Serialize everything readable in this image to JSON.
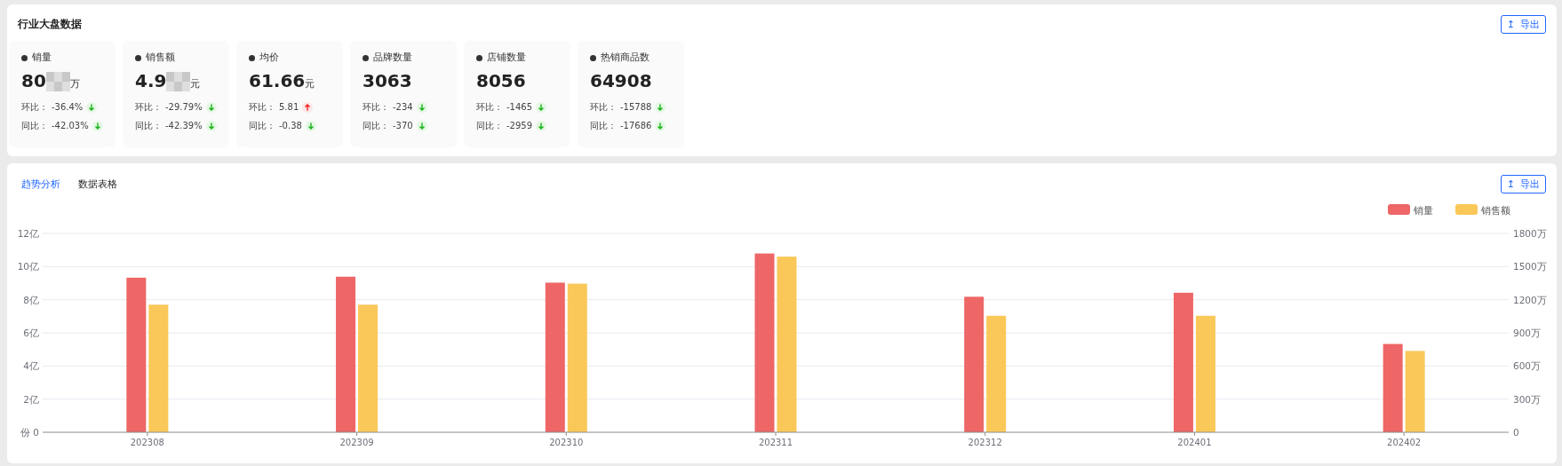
{
  "overview": {
    "title": "行业大盘数据",
    "export_button": {
      "icon": "↥",
      "label": "导出"
    },
    "metrics": [
      {
        "name": "销量",
        "value": "80",
        "unit": "万",
        "redacted": true,
        "rows": [
          {
            "label": "环比：",
            "value": "-36.4%",
            "rising": false
          },
          {
            "label": "同比：",
            "value": "-42.03%",
            "rising": false
          }
        ]
      },
      {
        "name": "销售额",
        "value": "4.9",
        "unit": "元",
        "redacted": true,
        "rows": [
          {
            "label": "环比：",
            "value": "-29.79%",
            "rising": false
          },
          {
            "label": "同比：",
            "value": "-42.39%",
            "rising": false
          }
        ]
      },
      {
        "name": "均价",
        "value": "61.66",
        "unit": "元",
        "redacted": false,
        "rows": [
          {
            "label": "环比：",
            "value": "5.81",
            "rising": true
          },
          {
            "label": "同比：",
            "value": "-0.38",
            "rising": false
          }
        ]
      },
      {
        "name": "品牌数量",
        "value": "3063",
        "redacted": false,
        "rows": [
          {
            "label": "环比：",
            "value": "-234",
            "rising": false
          },
          {
            "label": "同比：",
            "value": "-370",
            "rising": false
          }
        ]
      },
      {
        "name": "店铺数量",
        "value": "8056",
        "redacted": false,
        "rows": [
          {
            "label": "环比：",
            "value": "-1465",
            "rising": false
          },
          {
            "label": "同比：",
            "value": "-2959",
            "rising": false
          }
        ]
      },
      {
        "name": "热销商品数",
        "value": "64908",
        "redacted": false,
        "rows": [
          {
            "label": "环比：",
            "value": "-15788",
            "rising": false
          },
          {
            "label": "同比：",
            "value": "-17686",
            "rising": false
          }
        ]
      }
    ]
  },
  "analysis": {
    "tabs": [
      {
        "label": "趋势分析",
        "selected": true
      },
      {
        "label": "数据表格",
        "selected": false
      }
    ],
    "export_button": {
      "icon": "↥",
      "label": "导出"
    },
    "chart_data": {
      "type": "bar",
      "xlabel": "份",
      "grid": true,
      "legend": "top-right",
      "categories": [
        "202308",
        "202309",
        "202310",
        "202311",
        "202312",
        "202401",
        "202402"
      ],
      "series": [
        {
          "name": "销量",
          "color": "#ee6666",
          "values": [
            9.33,
            9.39,
            9.03,
            10.79,
            8.18,
            8.42,
            5.33
          ]
        },
        {
          "name": "销售额",
          "color": "#fac858",
          "values": [
            7.7,
            7.7,
            8.97,
            10.6,
            7.03,
            7.03,
            4.91
          ]
        }
      ],
      "ylim": [
        0,
        12
      ],
      "yticks": [
        {
          "value": 0,
          "label": "0"
        },
        {
          "value": 2,
          "label": "2亿"
        },
        {
          "value": 4,
          "label": "4亿"
        },
        {
          "value": 6,
          "label": "6亿"
        },
        {
          "value": 8,
          "label": "8亿"
        },
        {
          "value": 10,
          "label": "10亿"
        },
        {
          "value": 12,
          "label": "12亿"
        }
      ],
      "y2lim": [
        0,
        1800
      ],
      "y2ticks": [
        {
          "value": 0,
          "label": "0"
        },
        {
          "value": 300,
          "label": "300万"
        },
        {
          "value": 600,
          "label": "600万"
        },
        {
          "value": 900,
          "label": "900万"
        },
        {
          "value": 1200,
          "label": "1200万"
        },
        {
          "value": 1500,
          "label": "1500万"
        },
        {
          "value": 1800,
          "label": "1800万"
        }
      ]
    }
  }
}
